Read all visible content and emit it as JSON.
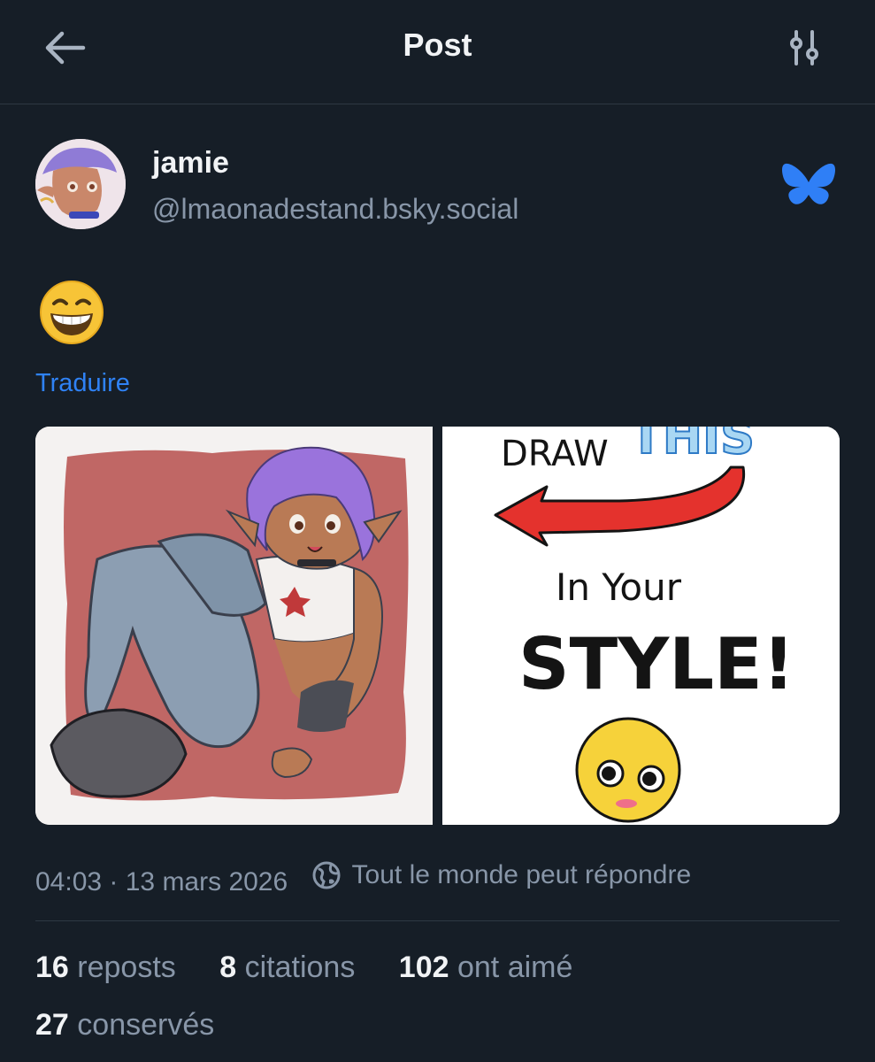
{
  "header": {
    "title": "Post",
    "back_icon": "arrow-left-icon",
    "settings_icon": "sliders-icon"
  },
  "author": {
    "display_name": "jamie",
    "handle": "@lmaonadestand.bsky.social",
    "service_icon": "bluesky-butterfly-icon"
  },
  "post": {
    "emoji_icon": "grinning-face-icon",
    "translate_label": "Traduire",
    "images": [
      "illustration-purple-hair-character",
      "draw-this-in-your-style-meme"
    ],
    "right_image_text": {
      "top": "DRAW THIS",
      "middle": "In Your",
      "bottom": "STYLE!"
    }
  },
  "meta": {
    "timestamp": "04:03 · 13 mars 2026",
    "reply_setting": "Tout le monde peut répondre",
    "reply_icon": "globe-icon"
  },
  "stats": [
    {
      "count": "16",
      "label": "reposts"
    },
    {
      "count": "8",
      "label": "citations"
    },
    {
      "count": "102",
      "label": "ont aimé"
    },
    {
      "count": "27",
      "label": "conservés"
    }
  ],
  "colors": {
    "background": "#161e27",
    "accent": "#2f82f5",
    "muted": "#8896a8",
    "text": "#f1f3f5"
  }
}
